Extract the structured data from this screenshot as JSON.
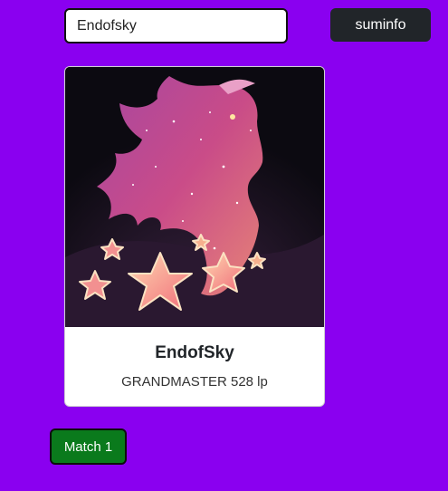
{
  "search": {
    "value": "Endofsky"
  },
  "summ_button": {
    "label": "suminfo"
  },
  "card": {
    "icon": "profile-icon-starry-silhouette",
    "name": "EndofSky",
    "rank_text": "GRANDMASTER 528 lp"
  },
  "matches": [
    {
      "label": "Match 1",
      "color": "#0a7a1c"
    }
  ],
  "colors": {
    "background": "#8a00f0",
    "button_dark": "#212529",
    "match_green": "#0a7a1c"
  }
}
